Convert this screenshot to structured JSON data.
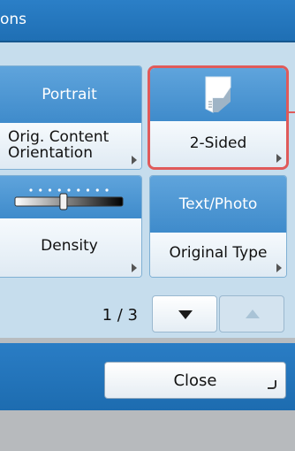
{
  "title_bar": {
    "text": "ons"
  },
  "tiles": {
    "orientation": {
      "top_label": "Portrait",
      "bottom_label_line1": "Orig. Content",
      "bottom_label_line2": "Orientation"
    },
    "two_sided": {
      "icon": "two-sided-page-icon",
      "bottom_label": "2-Sided"
    },
    "density": {
      "icon": "density-slider-icon",
      "level_fraction": 0.45,
      "bottom_label": "Density"
    },
    "original_type": {
      "top_label": "Text/Photo",
      "bottom_label": "Original Type"
    }
  },
  "pagination": {
    "current": 1,
    "total": 3,
    "text": "1 / 3",
    "down_icon": "down-triangle-icon",
    "up_icon": "up-triangle-icon"
  },
  "footer": {
    "close_label": "Close"
  },
  "colors": {
    "accent_blue": "#2b7fc7",
    "highlight_red": "#e05a5a",
    "panel_bg": "#c6dded"
  }
}
